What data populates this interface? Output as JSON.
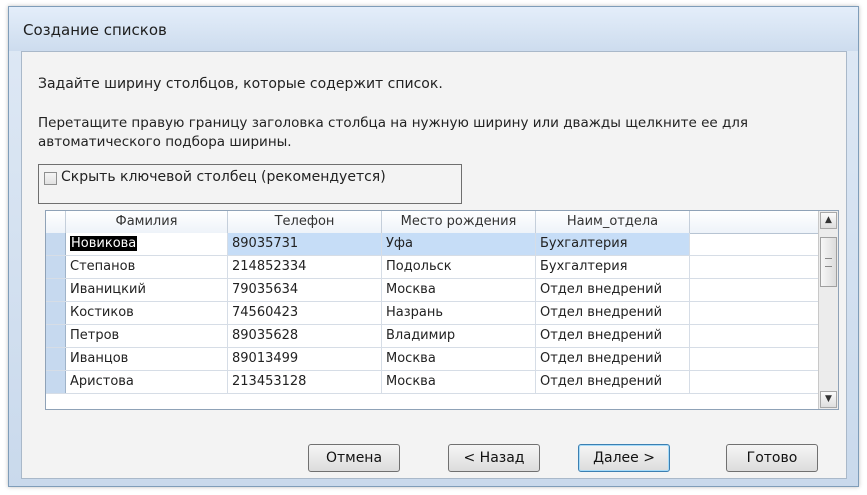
{
  "window": {
    "title": "Создание списков"
  },
  "instructions": {
    "line1": "Задайте ширину столбцов, которые содержит список.",
    "line2": "Перетащите правую границу заголовка столбца на нужную ширину или дважды щелкните ее для автоматического подбора ширины."
  },
  "hide_key": {
    "label": "Скрыть ключевой столбец (рекомендуется)",
    "checked": false
  },
  "grid": {
    "columns": [
      "Фамилия",
      "Телефон",
      "Место рождения",
      "Наим_отдела"
    ],
    "rows": [
      [
        "Новикова",
        "89035731",
        "Уфа",
        "Бухгалтерия"
      ],
      [
        "Степанов",
        "214852334",
        "Подольск",
        "Бухгалтерия"
      ],
      [
        "Иваницкий",
        "79035634",
        "Москва",
        "Отдел внедрений"
      ],
      [
        "Костиков",
        "74560423",
        "Назрань",
        "Отдел внедрений"
      ],
      [
        "Петров",
        "89035628",
        "Владимир",
        "Отдел внедрений"
      ],
      [
        "Иванцов",
        "89013499",
        "Москва",
        "Отдел внедрений"
      ],
      [
        "Аристова",
        "213453128",
        "Москва",
        "Отдел внедрений"
      ]
    ],
    "selected_row": 0
  },
  "buttons": {
    "cancel": "Отмена",
    "back": "< Назад",
    "next": "Далее >",
    "finish": "Готово"
  },
  "icons": {
    "scroll_up": "scroll-up-arrow-icon",
    "scroll_down": "scroll-down-arrow-icon"
  }
}
